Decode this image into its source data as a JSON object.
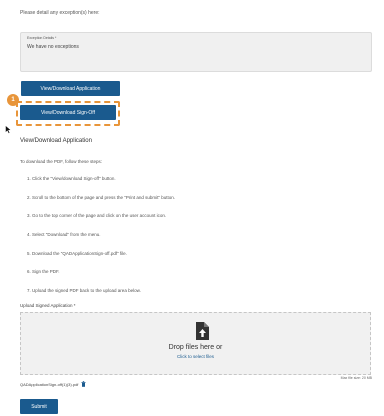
{
  "intro_text": "Please detail any exception(s) here:",
  "exceptions": {
    "label": "Exception Details *",
    "value": "We have no exceptions"
  },
  "buttons": {
    "view_application": "View/Download Application",
    "view_signoff": "View/Download Sign-Off",
    "submit": "Submit"
  },
  "step_badge": "1",
  "section": {
    "title": "View/Download Application",
    "instructions_intro": "To download the PDF, follow these steps:",
    "steps": [
      "1. Click the \"View/download Sign-off\" button.",
      "2. Scroll to the bottom of the page and press the \"Print and submit\" button.",
      "3. Go to the top corner of the page and click on the user account icon.",
      "4. Select \"Download\" from the menu.",
      "5. Download the \"QADApplicationSign-off.pdf\" file.",
      "6. Sign the PDF.",
      "7. Upload the signed PDF back to the upload area below."
    ]
  },
  "upload": {
    "label": "Upload Signed Application *",
    "drop_text": "Drop files here or",
    "select_text": "Click to select files",
    "max_size": "Max file size: 20 MB",
    "file_name": "QADApplicationSign-off(1)(3).pdf"
  },
  "colors": {
    "primary": "#1a5a8e",
    "highlight": "#e8953a"
  },
  "icons": [
    "cursor-icon",
    "file-upload-icon",
    "trash-icon"
  ]
}
